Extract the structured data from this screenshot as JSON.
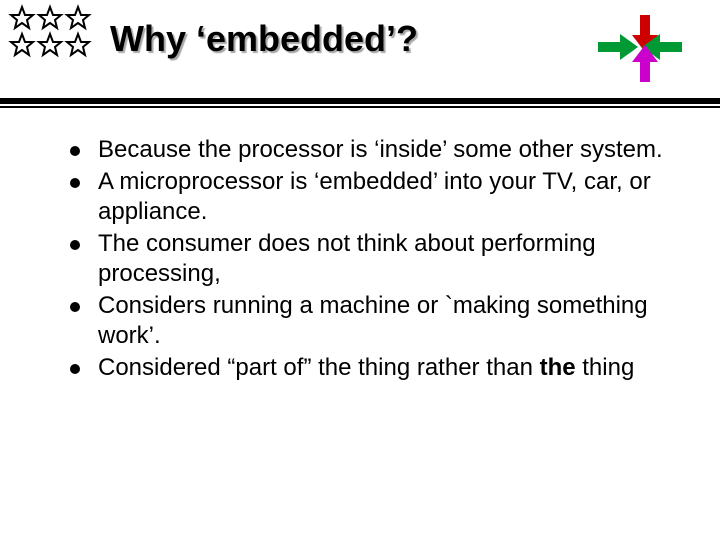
{
  "title": "Why ‘embedded’?",
  "bullets": [
    {
      "pre": "Because the processor is ‘inside’ some other system.",
      "bold": "",
      "post": ""
    },
    {
      "pre": "A microprocessor is ‘embedded’ into your TV, car, or appliance.",
      "bold": "",
      "post": ""
    },
    {
      "pre": "The consumer does not think about performing processing,",
      "bold": "",
      "post": ""
    },
    {
      "pre": "Considers running a machine or `making something work’.",
      "bold": "",
      "post": ""
    },
    {
      "pre": "Considered “part of” the thing rather than ",
      "bold": "the",
      "post": " thing"
    }
  ],
  "decor": {
    "stars": "stars-outline-cluster",
    "arrows": "converging-arrows"
  }
}
